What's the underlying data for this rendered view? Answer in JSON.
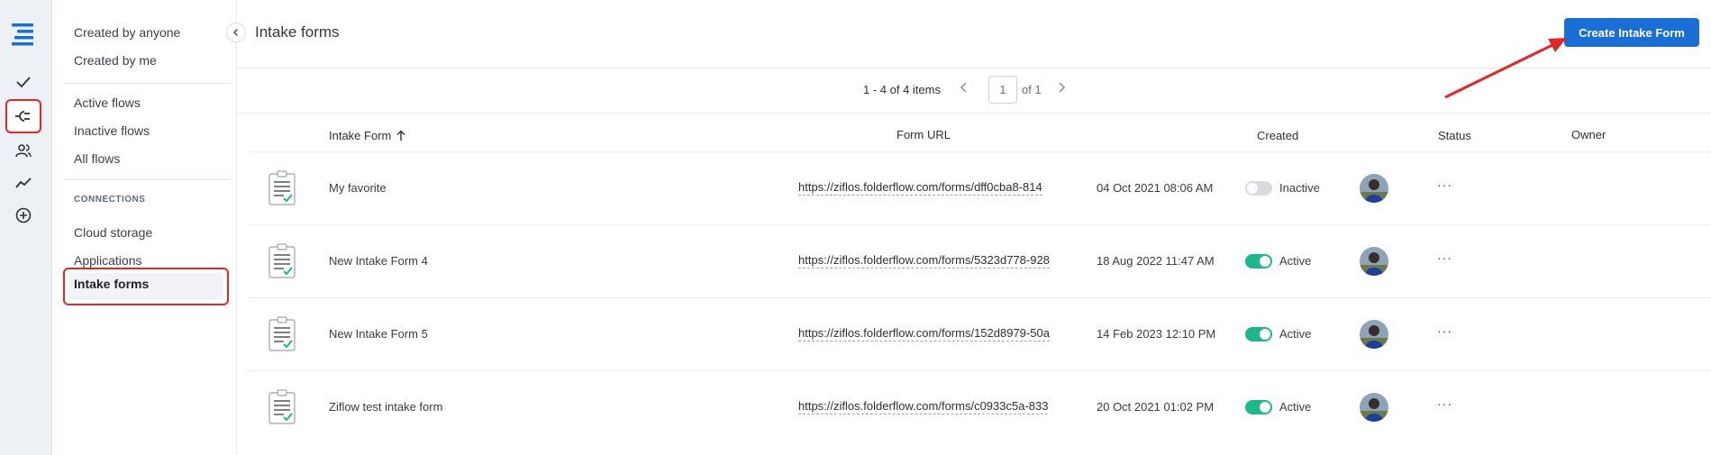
{
  "rail": {
    "icons": [
      "menu-logo-icon",
      "check-icon",
      "plug-icon",
      "users-icon",
      "trend-icon",
      "add-circle-icon"
    ]
  },
  "sidenav": {
    "created_by_anyone": "Created by anyone",
    "created_by_me": "Created by me",
    "active_flows": "Active flows",
    "inactive_flows": "Inactive flows",
    "all_flows": "All flows",
    "connections_heading": "CONNECTIONS",
    "cloud_storage": "Cloud storage",
    "applications": "Applications",
    "intake_forms": "Intake forms"
  },
  "header": {
    "title": "Intake forms",
    "create_button": "Create Intake Form"
  },
  "pager": {
    "range": "1 - 4 of 4 items",
    "page": "1",
    "of_total": "of 1"
  },
  "table": {
    "columns": {
      "intake_form": "Intake Form",
      "form_url": "Form URL",
      "created": "Created",
      "status": "Status",
      "owner": "Owner"
    },
    "rows": [
      {
        "name": "My favorite",
        "url": "https://ziflos.folderflow.com/forms/dff0cba8-814",
        "created": "04 Oct 2021 08:06 AM",
        "status": "Inactive",
        "active": false
      },
      {
        "name": "New Intake Form 4",
        "url": "https://ziflos.folderflow.com/forms/5323d778-928",
        "created": "18 Aug 2022 11:47 AM",
        "status": "Active",
        "active": true
      },
      {
        "name": "New Intake Form 5",
        "url": "https://ziflos.folderflow.com/forms/152d8979-50a",
        "created": "14 Feb 2023 12:10 PM",
        "status": "Active",
        "active": true
      },
      {
        "name": "Ziflow test intake form",
        "url": "https://ziflos.folderflow.com/forms/c0933c5a-833",
        "created": "20 Oct 2021 01:02 PM",
        "status": "Active",
        "active": true
      }
    ],
    "more_label": "···"
  },
  "colors": {
    "accent": "#1b6ed6",
    "active_toggle": "#1fb58d",
    "highlight": "#e0272a"
  }
}
